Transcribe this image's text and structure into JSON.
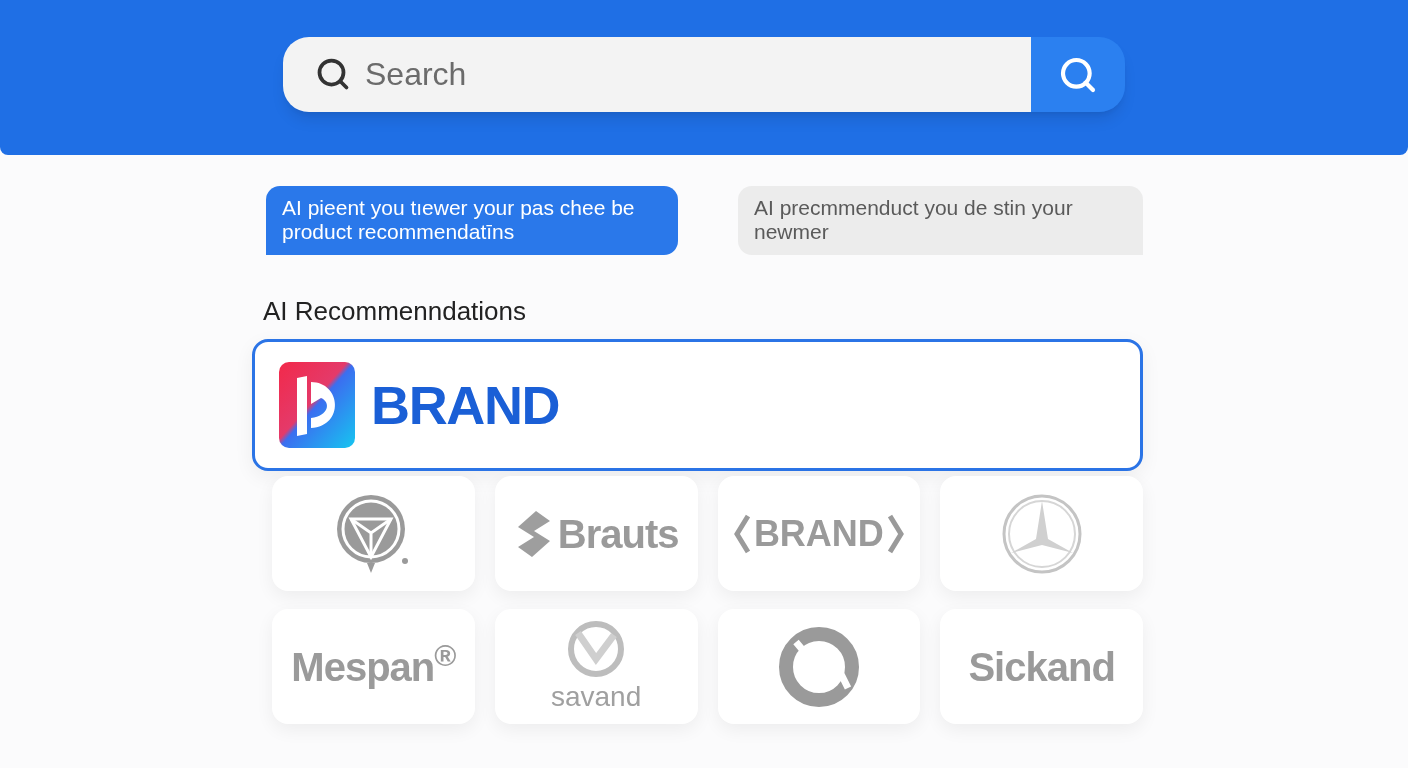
{
  "search": {
    "placeholder": "Search"
  },
  "messages": [
    {
      "kind": "sent",
      "text": "AI pieent you tıewer your pas chee be product recommendatīns"
    },
    {
      "kind": "received",
      "text": "AI precmmenduct you de stin your newmer"
    }
  ],
  "section_title": "AI Recommenndations",
  "featured": {
    "name": "BRAND",
    "selected": true
  },
  "brands": [
    {
      "kind": "emblem"
    },
    {
      "kind": "wordmark",
      "name": "Brauts"
    },
    {
      "kind": "bracketed",
      "name": "BRAND"
    },
    {
      "kind": "emblem"
    },
    {
      "kind": "wordmark",
      "name": "Mespan$^{®}$"
    },
    {
      "kind": "stacked",
      "name": "savand"
    },
    {
      "kind": "emblem"
    },
    {
      "kind": "wordmark",
      "name": "Sickand"
    }
  ]
}
